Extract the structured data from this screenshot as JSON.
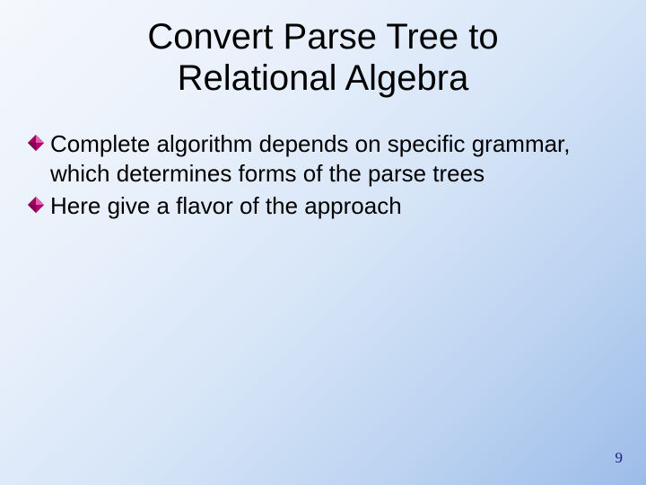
{
  "slide": {
    "title_line1": "Convert Parse Tree to",
    "title_line2": "Relational Algebra",
    "bullets": [
      "Complete algorithm depends on specific grammar, which determines forms of the parse trees",
      "Here give a flavor of the approach"
    ],
    "page_number": "9"
  }
}
